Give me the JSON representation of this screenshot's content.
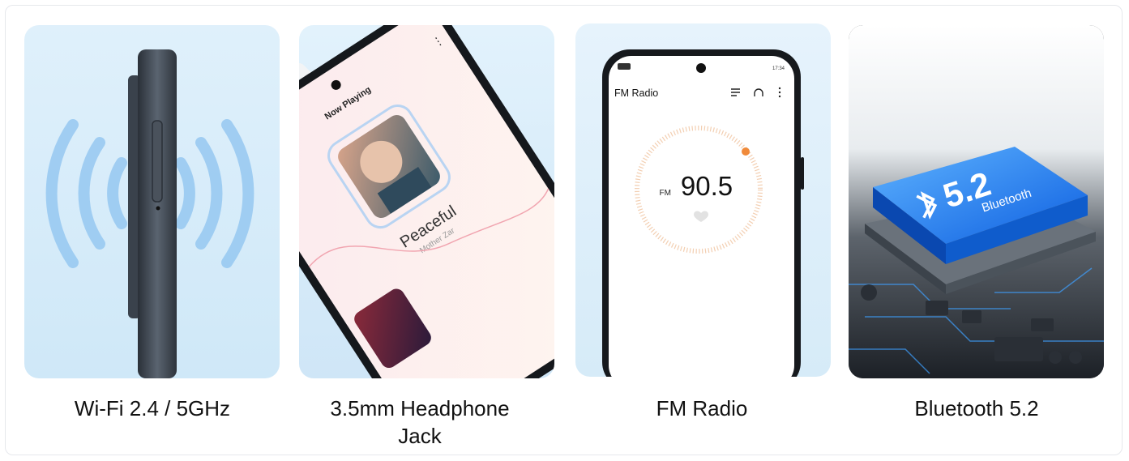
{
  "features": [
    {
      "caption_lines": [
        "Wi-Fi 2.4 / 5GHz"
      ]
    },
    {
      "caption_lines": [
        "3.5mm Headphone",
        "Jack"
      ]
    },
    {
      "caption_lines": [
        "FM Radio"
      ]
    },
    {
      "caption_lines": [
        "Bluetooth 5.2"
      ]
    }
  ],
  "music_app": {
    "header": "Now Playing",
    "song_title": "Peaceful",
    "artist": "Mother Zar"
  },
  "radio_app": {
    "title": "FM Radio",
    "band": "FM",
    "frequency": "90.5",
    "status_time": "17:34"
  },
  "chip": {
    "version": "5.2",
    "label": "Bluetooth"
  },
  "colors": {
    "accent_orange": "#f08a3a",
    "chip_blue": "#1e7bff",
    "wave_blue": "#7fb8ee"
  }
}
